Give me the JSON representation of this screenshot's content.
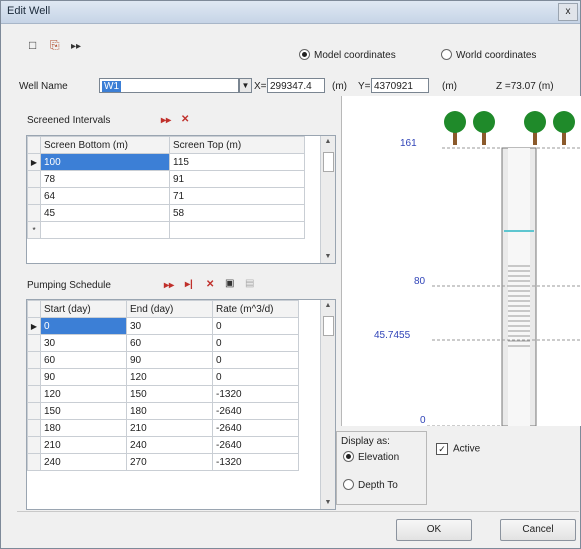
{
  "window": {
    "title": "Edit Well",
    "close": "x"
  },
  "toolbar": {
    "new": "□",
    "copy": "⎘",
    "insert": "▸▸"
  },
  "coord_mode": {
    "model": "Model coordinates",
    "world": "World coordinates",
    "selected": "model"
  },
  "well": {
    "name_label": "Well Name",
    "name_value": "W1",
    "x_label": "X=",
    "x_value": "299347.4",
    "x_unit": "(m)",
    "y_label": "Y=",
    "y_value": "4370921",
    "y_unit": "(m)",
    "z_text": "Z =73.07 (m)"
  },
  "screened": {
    "title": "Screened Intervals",
    "headers": [
      "Screen Bottom (m)",
      "Screen Top (m)"
    ],
    "rows": [
      [
        "100",
        "115"
      ],
      [
        "78",
        "91"
      ],
      [
        "64",
        "71"
      ],
      [
        "45",
        "58"
      ]
    ]
  },
  "pumping": {
    "title": "Pumping Schedule",
    "headers": [
      "Start (day)",
      "End (day)",
      "Rate (m^3/d)"
    ],
    "rows": [
      [
        "0",
        "30",
        "0"
      ],
      [
        "30",
        "60",
        "0"
      ],
      [
        "60",
        "90",
        "0"
      ],
      [
        "90",
        "120",
        "0"
      ],
      [
        "120",
        "150",
        "-1320"
      ],
      [
        "150",
        "180",
        "-2640"
      ],
      [
        "180",
        "210",
        "-2640"
      ],
      [
        "210",
        "240",
        "-2640"
      ],
      [
        "240",
        "270",
        "-1320"
      ]
    ]
  },
  "diagram": {
    "labels": [
      "161",
      "80",
      "45.7455",
      "0"
    ]
  },
  "display": {
    "title": "Display as:",
    "elevation": "Elevation",
    "depth": "Depth To",
    "selected": "elevation"
  },
  "active": {
    "label": "Active",
    "checked": true
  },
  "buttons": {
    "ok": "OK",
    "cancel": "Cancel"
  },
  "colors": {
    "selection": "#3c7fd6",
    "label_blue": "#3044b8",
    "tree_green": "#1f8a2a",
    "trunk": "#8b5a2b"
  }
}
